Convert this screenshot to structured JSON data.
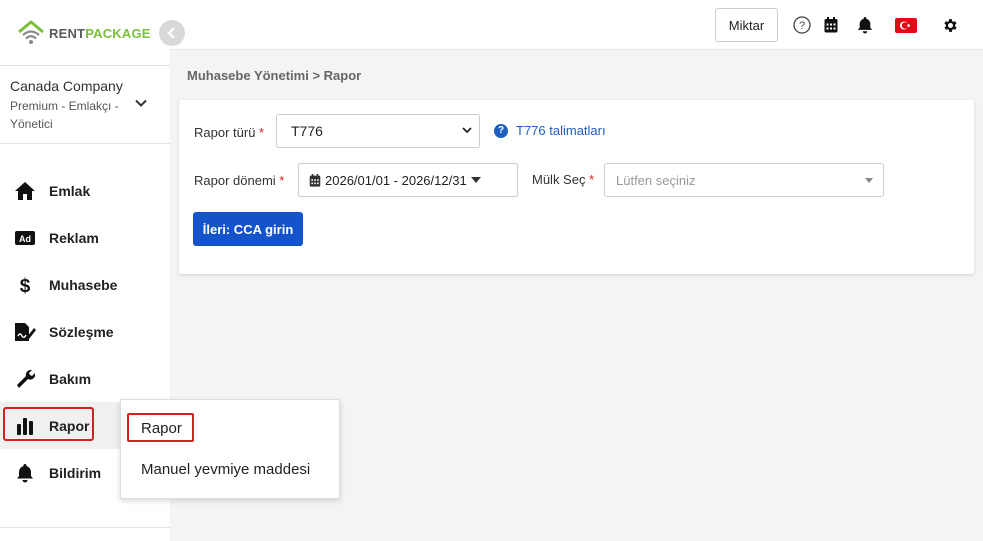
{
  "brand": {
    "part1": "RENT",
    "part2": "PACKAGE"
  },
  "company": {
    "name": "Canada Company",
    "role": "Premium - Emlakçı - Yönetici"
  },
  "nav": [
    {
      "label": "Emlak",
      "icon": "home-icon"
    },
    {
      "label": "Reklam",
      "icon": "ad-icon"
    },
    {
      "label": "Muhasebe",
      "icon": "dollar-icon"
    },
    {
      "label": "Sözleşme",
      "icon": "contract-sign-icon"
    },
    {
      "label": "Bakım",
      "icon": "wrench-icon"
    },
    {
      "label": "Rapor",
      "icon": "bar-chart-icon"
    },
    {
      "label": "Bildirim",
      "icon": "bell-icon"
    }
  ],
  "topbar": {
    "miktar_label": "Miktar"
  },
  "breadcrumb": "Muhasebe Yönetimi > Rapor",
  "form": {
    "report_type_label": "Rapor türü",
    "report_type_value": "T776",
    "help_link": "T776 talimatları",
    "period_label": "Rapor dönemi",
    "period_value": "2026/01/01 - 2026/12/31",
    "property_label": "Mülk Seç",
    "property_placeholder": "Lütfen seçiniz",
    "next_button": "İleri: CCA girin",
    "required_mark": "*"
  },
  "popover": {
    "items": [
      "Rapor",
      "Manuel yevmiye maddesi"
    ]
  },
  "colors": {
    "primary": "#1453c9",
    "brand_green": "#7cbf3a",
    "highlight_red": "#d32020"
  }
}
